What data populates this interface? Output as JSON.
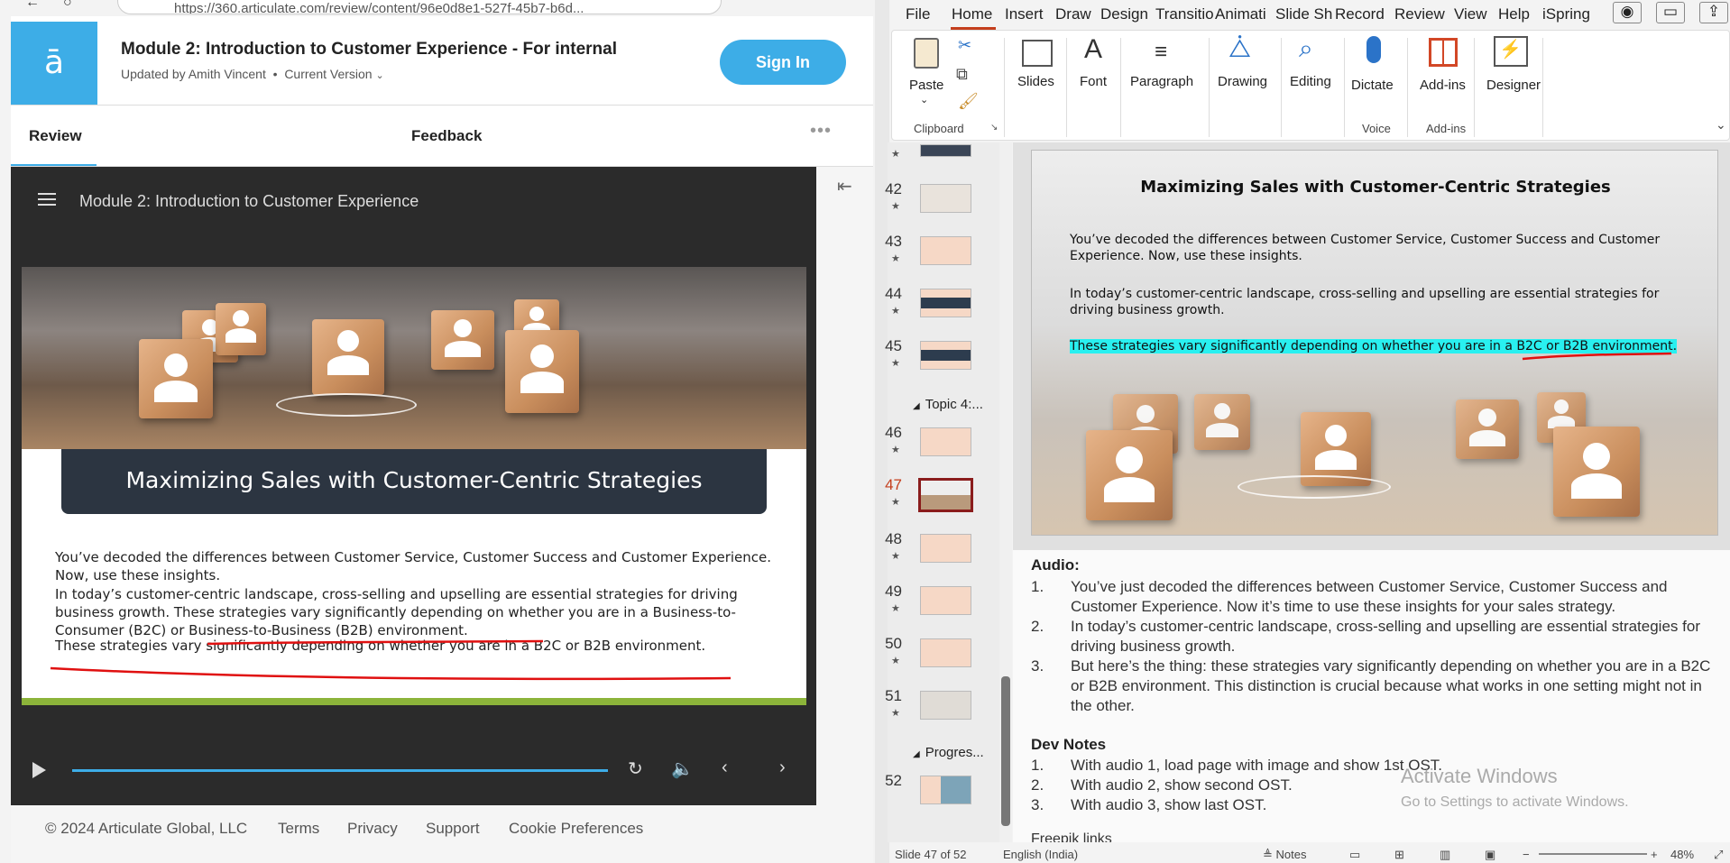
{
  "browser": {
    "url": "https://360.articulate.com/review/content/96e0d8e1-527f-45b7-b6d...",
    "module_title": "Module 2: Introduction to Customer Experience - For internal",
    "updated_by": "Updated by Amith Vincent",
    "separator": "•",
    "version_label": "Current Version",
    "sign_in": "Sign In",
    "tabs": {
      "review": "Review",
      "feedback": "Feedback"
    },
    "more": "•••",
    "logo_glyph": "ā"
  },
  "player": {
    "title": "Module 2: Introduction to Customer Experience",
    "progress": 1.0
  },
  "slide": {
    "title": "Maximizing Sales with Customer-Centric Strategies",
    "para1": "You’ve decoded the differences between Customer Service, Customer Success and Customer Experience. Now, use these insights.",
    "para2": "In today’s customer-centric landscape, cross-selling and upselling are essential strategies for driving business growth. These strategies vary significantly depending on whether you are in a Business-to-Consumer (B2C) or Business-to-Business (B2B) environment.",
    "para3": "These strategies vary significantly depending on whether you are in a B2C or B2B environment."
  },
  "footer": {
    "copyright": "© 2024 Articulate Global, LLC",
    "links": [
      "Terms",
      "Privacy",
      "Support",
      "Cookie Preferences"
    ]
  },
  "ppt": {
    "menu": [
      "File",
      "Home",
      "Insert",
      "Draw",
      "Design",
      "Transitio",
      "Animati",
      "Slide Sh",
      "Record",
      "Review",
      "View",
      "Help",
      "iSpring"
    ],
    "ribbon": {
      "paste": "Paste",
      "clipboard": "Clipboard",
      "slides": "Slides",
      "font": "Font",
      "paragraph": "Paragraph",
      "drawing": "Drawing",
      "editing": "Editing",
      "dictate": "Dictate",
      "voice": "Voice",
      "addins": "Add-ins",
      "addins_group": "Add-ins",
      "designer": "Designer"
    },
    "thumbnails": [
      {
        "num": "42",
        "star": "★"
      },
      {
        "num": "43",
        "star": "★"
      },
      {
        "num": "44",
        "star": "★"
      },
      {
        "num": "45",
        "star": "★"
      },
      {
        "num": "46",
        "star": "★"
      },
      {
        "num": "47",
        "star": "★"
      },
      {
        "num": "48",
        "star": "★"
      },
      {
        "num": "49",
        "star": "★"
      },
      {
        "num": "50",
        "star": "★"
      },
      {
        "num": "51",
        "star": "★"
      },
      {
        "num": "52",
        "star": ""
      }
    ],
    "sections": [
      "Topic 4:...",
      "Progres..."
    ],
    "active_slide": "47",
    "slide": {
      "title": "Maximizing Sales with Customer-Centric Strategies",
      "para1": "You’ve decoded the differences between Customer Service, Customer Success and Customer Experience. Now, use these insights.",
      "para2": "In today’s customer-centric landscape, cross-selling and upselling are essential strategies for driving business growth.",
      "para3": "These strategies vary significantly depending on whether you are in a B2C or B2B environment."
    },
    "notes": {
      "audio_heading": "Audio:",
      "audio_items": [
        {
          "n": "1.",
          "t": "You’ve just decoded the differences between Customer Service, Customer Success and Customer Experience. Now it’s time to use these insights for your sales strategy."
        },
        {
          "n": "2.",
          "t": "In today’s customer-centric landscape, cross-selling and upselling are essential strategies for driving business growth."
        },
        {
          "n": "3.",
          "t": "But here’s the thing: these strategies vary significantly depending on whether you are in a B2C or B2B environment. This distinction is crucial because what works in one setting might not in the other."
        }
      ],
      "dev_heading": "Dev Notes",
      "dev_items": [
        {
          "n": "1.",
          "t": "With audio 1, load page with image and show 1st OST."
        },
        {
          "n": "2.",
          "t": "With audio 2, show second OST."
        },
        {
          "n": "3.",
          "t": "With audio 3, show last OST."
        }
      ],
      "freepik": "Freepik links"
    },
    "activate": {
      "title": "Activate Windows",
      "sub": "Go to Settings to activate Windows."
    },
    "status": {
      "slide_of": "Slide 47 of 52",
      "language": "English (India)",
      "notes": "Notes",
      "zoom": "48%"
    }
  }
}
